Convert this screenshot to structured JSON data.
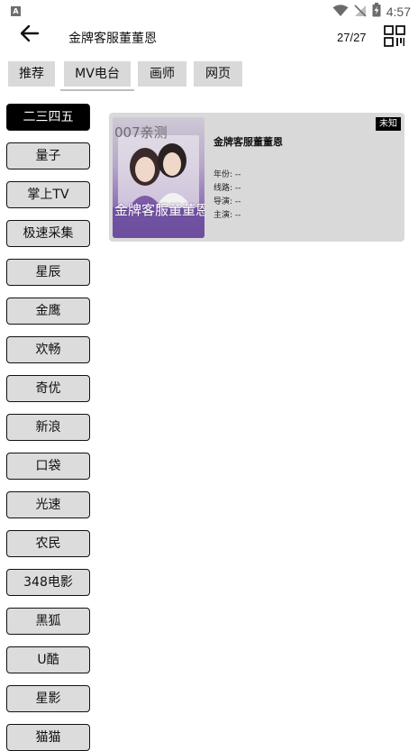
{
  "status_bar": {
    "app_icon_letter": "A",
    "time": "4:57",
    "icons": [
      "wifi-icon",
      "no-signal-icon",
      "battery-charging-icon"
    ]
  },
  "header": {
    "title": "金牌客服董董恩",
    "count": "27/27",
    "back_icon": "arrow-left-icon",
    "qr_icon": "qr-code-icon"
  },
  "tabs": [
    {
      "label": "推荐"
    },
    {
      "label": "MV电台",
      "active": true
    },
    {
      "label": "画师"
    },
    {
      "label": "网页"
    }
  ],
  "sidebar": {
    "items": [
      {
        "label": "二三四五",
        "active": true
      },
      {
        "label": "量子"
      },
      {
        "label": "掌上TV"
      },
      {
        "label": "极速采集"
      },
      {
        "label": "星辰"
      },
      {
        "label": "金鹰"
      },
      {
        "label": "欢畅"
      },
      {
        "label": "奇优"
      },
      {
        "label": "新浪"
      },
      {
        "label": "口袋"
      },
      {
        "label": "光速"
      },
      {
        "label": "农民"
      },
      {
        "label": "348电影"
      },
      {
        "label": "黑狐"
      },
      {
        "label": "U酷"
      },
      {
        "label": "星影"
      },
      {
        "label": "猫猫"
      }
    ]
  },
  "results": [
    {
      "title": "金牌客服董董恩",
      "badge": "未知",
      "poster_watermark": "007亲测",
      "poster_caption": "金牌客服董董恩",
      "year": "年份: --",
      "route": "线路: --",
      "director": "导演: --",
      "cast": "主演: --"
    }
  ],
  "colors": {
    "active_bg": "#000000",
    "inactive_bg": "#d9d9d9",
    "card_bg": "#d9d9d9"
  }
}
